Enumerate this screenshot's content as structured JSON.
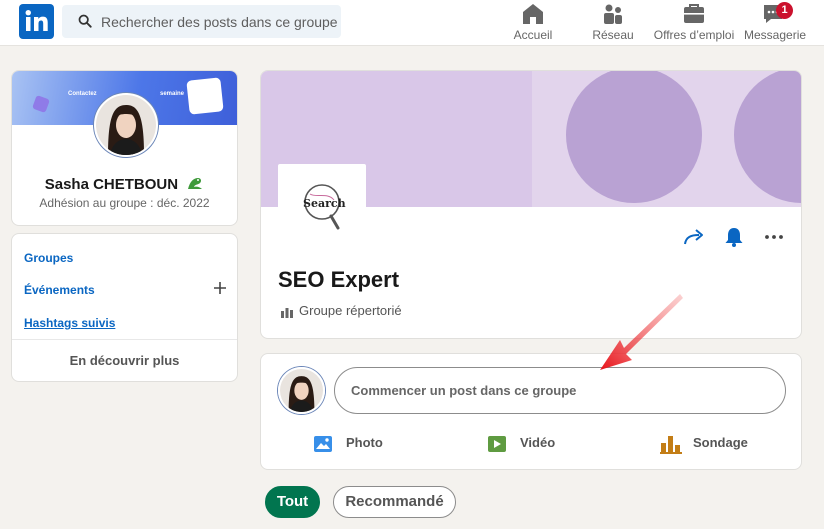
{
  "header": {
    "search_placeholder": "Rechercher des posts dans ce groupe",
    "nav": [
      {
        "label": "Accueil",
        "icon": "home-icon"
      },
      {
        "label": "Réseau",
        "icon": "network-icon"
      },
      {
        "label": "Offres d’emploi",
        "icon": "briefcase-icon"
      },
      {
        "label": "Messagerie",
        "icon": "messaging-icon",
        "badge": "1"
      }
    ]
  },
  "profile": {
    "name": "Sasha CHETBOUN",
    "membership": "Adhésion au groupe : déc. 2022",
    "banner_text": "Contactez",
    "banner_text_right": "semaine"
  },
  "leftnav": {
    "items": [
      "Groupes",
      "Événements",
      "Hashtags suivis"
    ],
    "discover": "En découvrir plus"
  },
  "group": {
    "title": "SEO Expert",
    "type": "Groupe répertorié",
    "logo_text": "Search"
  },
  "composer": {
    "placeholder": "Commencer un post dans ce groupe",
    "actions": [
      {
        "label": "Photo",
        "icon": "photo-icon",
        "color": "#378fe9"
      },
      {
        "label": "Vidéo",
        "icon": "video-icon",
        "color": "#5f9b41"
      },
      {
        "label": "Sondage",
        "icon": "poll-icon",
        "color": "#c37d16"
      }
    ]
  },
  "filters": {
    "active": "Tout",
    "inactive": "Recommandé"
  },
  "colors": {
    "brand": "#0a66c2",
    "pill_active": "#01754f",
    "badge": "#cb112d",
    "annotation_arrow": "#e8141b"
  }
}
